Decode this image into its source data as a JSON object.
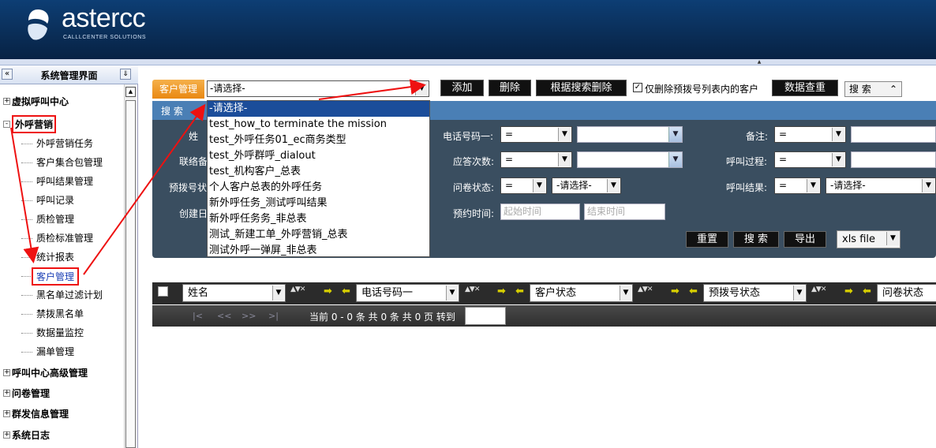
{
  "brand": {
    "name": "astercc",
    "sub": "CALLLCENTER SOLUTIONS"
  },
  "sidebar": {
    "title": "系统管理界面",
    "collapse_icon": "«",
    "pin_icon": "⇓",
    "groups": [
      {
        "label": "虚拟呼叫中心",
        "toggle": "+"
      },
      {
        "label": "外呼营销",
        "toggle": "-"
      },
      {
        "label": "呼叫中心高级管理",
        "toggle": "+"
      },
      {
        "label": "问卷管理",
        "toggle": "+"
      },
      {
        "label": "群发信息管理",
        "toggle": "+"
      },
      {
        "label": "系统日志",
        "toggle": "+"
      }
    ],
    "items": [
      "外呼营销任务",
      "客户集合包管理",
      "呼叫结果管理",
      "呼叫记录",
      "质检管理",
      "质检标准管理",
      "统计报表",
      "客户管理",
      "黑名单过滤计划",
      "禁拨黑名单",
      "数据量监控",
      "漏单管理"
    ]
  },
  "toolbar": {
    "tab_label": "客户管理",
    "select_value": "-请选择-",
    "add": "添加",
    "delete": "删除",
    "delete_by_search": "根据搜索删除",
    "checkbox_label": "仅删除预拨号列表内的客户",
    "checkbox_mark": "☑",
    "dedupe": "数据查重",
    "search_toggle": "搜 索"
  },
  "dropdown_options": [
    "-请选择-",
    "test_how_to terminate the mission",
    "test_外呼任务01_ec商务类型",
    "test_外呼群呼_dialout",
    "test_机构客户_总表",
    "个人客户总表的外呼任务",
    "新外呼任务_测试呼叫结果",
    "新外呼任务务_非总表",
    "测试_新建工单_外呼营销_总表",
    "测试外呼一弹屏_非总表"
  ],
  "search": {
    "section_label": "搜 索",
    "left_labels": [
      "姓",
      "联络备",
      "预拨号状",
      "创建日"
    ],
    "phone1_label": "电话号码一:",
    "answer_label": "应答次数:",
    "survey_label": "问卷状态:",
    "appoint_label": "预约时间:",
    "note_label": "备注:",
    "process_label": "呼叫过程:",
    "result_label": "呼叫结果:",
    "eq": "=",
    "choose": "-请选择-",
    "start_ph": "起始时间",
    "end_ph": "结束时间",
    "reset": "重置",
    "search_btn": "搜 索",
    "export": "导出",
    "export_format": "xls file"
  },
  "grid": {
    "columns": [
      "姓名",
      "电话号码一",
      "客户状态",
      "预拨号状态",
      "问卷状态"
    ],
    "pager": {
      "first": "|<",
      "prev": "<<",
      "next": ">>",
      "last": ">|",
      "info": "当前 0 - 0 条 共 0 条 共 0 页 转到"
    }
  }
}
